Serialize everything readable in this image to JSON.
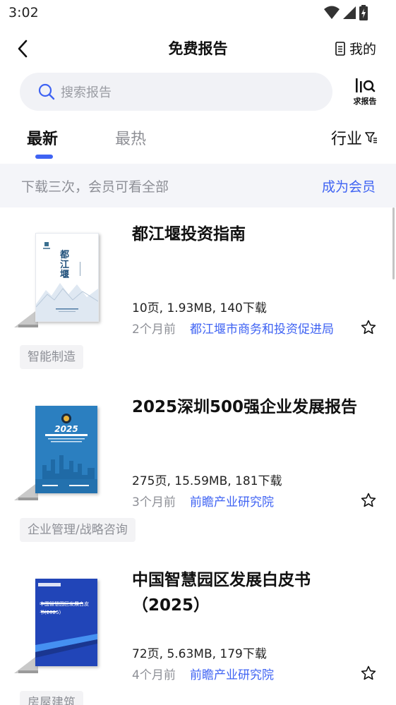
{
  "status": {
    "time": "3:02"
  },
  "nav": {
    "title": "免费报告",
    "my_label": "我的"
  },
  "search": {
    "placeholder": "搜索报告",
    "request_label": "求报告"
  },
  "tabs": {
    "latest": "最新",
    "hot": "最热",
    "industry": "行业"
  },
  "banner": {
    "text": "下载三次，会员可看全部",
    "link": "成为会员"
  },
  "reports": [
    {
      "title": "都江堰投资指南",
      "meta": "10页, 1.93MB, 140下载",
      "date": "2个月前",
      "source": "都江堰市商务和投资促进局",
      "tag": "智能制造",
      "cover_text": "都江堰"
    },
    {
      "title": "2025深圳500强企业发展报告",
      "meta": "275页, 15.59MB, 181下载",
      "date": "3个月前",
      "source": "前瞻产业研究院",
      "tag": "企业管理/战略咨询",
      "cover_text": "2025"
    },
    {
      "title": "中国智慧园区发展白皮书（2025）",
      "meta": "72页, 5.63MB, 179下载",
      "date": "4个月前",
      "source": "前瞻产业研究院",
      "tag": "房屋建筑",
      "cover_text": "中国智慧园区发展白皮书(2025)"
    }
  ],
  "colors": {
    "accent": "#3f63f3",
    "banner_bg": "#f4f5f9",
    "muted": "#8d8f96"
  }
}
